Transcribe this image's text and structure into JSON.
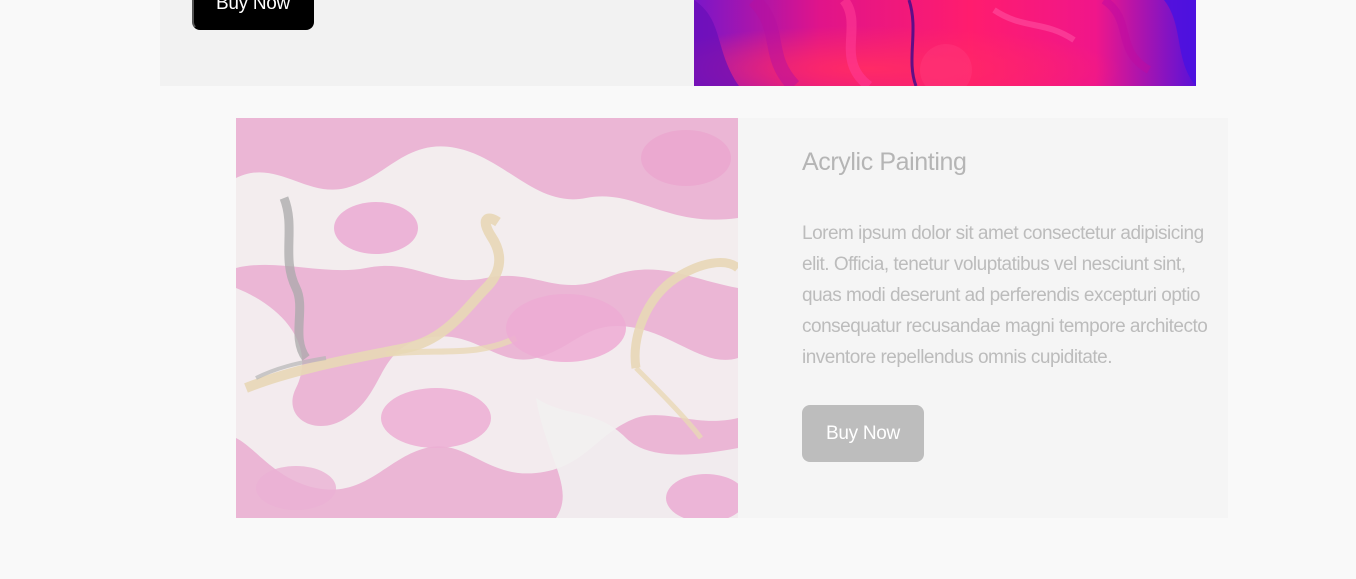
{
  "previous_card": {
    "button_label": "Buy Now"
  },
  "product_card": {
    "title": "Acrylic Painting",
    "description": "Lorem ipsum dolor sit amet consectetur adipisicing elit. Officia, tenetur voluptatibus vel nesciunt sint, quas modi deserunt ad perferendis excepturi optio consequatur recusandae magni tempore architecto inventore repellendus omnis cupiditate.",
    "button_label": "Buy Now"
  },
  "colors": {
    "page_background": "#f9f9f9",
    "card_background": "#f2f2f2",
    "primary_button": "#000000",
    "faded_button": "#bdbdbd",
    "faded_text": "#bcbcbc",
    "art_magenta": "#ff1477",
    "art_violet": "#5a0fd6",
    "art_pink": "#eab6d8"
  },
  "icons": {
    "previous_card_image": "abstract-magenta-violet-paint-image",
    "product_card_image": "pink-marble-acrylic-pour-image"
  }
}
